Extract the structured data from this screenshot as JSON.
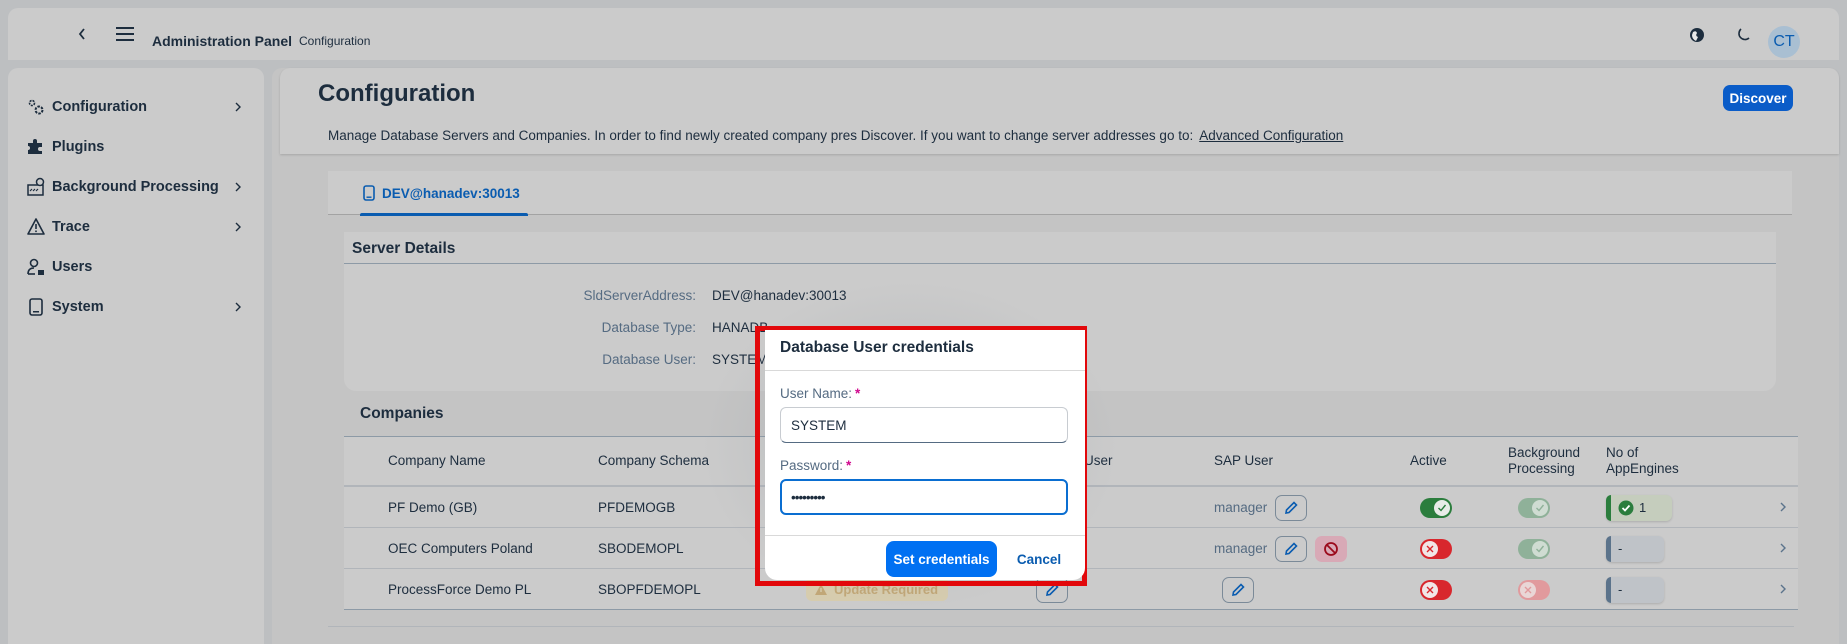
{
  "shell": {
    "title": "Administration Panel",
    "subtitle": "Configuration",
    "avatar_initials": "CT",
    "icons": {
      "back": "chevron-left-icon",
      "menu": "hamburger-menu-icon",
      "language": "globe-icon",
      "theme": "moon-icon"
    }
  },
  "sidebar": {
    "items": [
      {
        "label": "Configuration",
        "icon": "gears-icon",
        "expandable": true
      },
      {
        "label": "Plugins",
        "icon": "puzzle-icon",
        "expandable": false
      },
      {
        "label": "Background Processing",
        "icon": "background-process-icon",
        "expandable": true
      },
      {
        "label": "Trace",
        "icon": "warning-triangle-icon",
        "expandable": true
      },
      {
        "label": "Users",
        "icon": "user-list-icon",
        "expandable": false
      },
      {
        "label": "System",
        "icon": "device-icon",
        "expandable": true
      }
    ]
  },
  "page": {
    "title": "Configuration",
    "description": "Manage Database Servers and Companies. In order to find newly created company pres Discover. If you want to change server addresses go to:",
    "link_label": "Advanced Configuration",
    "discover_label": "Discover",
    "tabs": [
      {
        "label": "DEV@hanadev:30013",
        "icon": "device-icon",
        "selected": true
      }
    ]
  },
  "server_details": {
    "title": "Server Details",
    "fields": [
      {
        "label": "SldServerAddress:",
        "value": "DEV@hanadev:30013"
      },
      {
        "label": "Database Type:",
        "value": "HANADB"
      },
      {
        "label": "Database User:",
        "value": "SYSTEM"
      }
    ]
  },
  "companies": {
    "title": "Companies",
    "columns": [
      "Company Name",
      "Company Schema",
      "",
      "User",
      "SAP User",
      "Active",
      "Background Processing",
      "No of AppEngines"
    ],
    "rows": [
      {
        "name": "PF Demo (GB)",
        "schema": "PFDEMOGB",
        "status": "",
        "sap_user": "manager",
        "blocked": false,
        "active": true,
        "background": true,
        "appengines": "1",
        "appengines_ok": true
      },
      {
        "name": "OEC Computers Poland",
        "schema": "SBODEMOPL",
        "status": "",
        "sap_user": "manager",
        "blocked": true,
        "active": false,
        "background": true,
        "appengines": "-",
        "appengines_ok": false
      },
      {
        "name": "ProcessForce Demo PL",
        "schema": "SBOPFDEMOPL",
        "status": "Update Required",
        "sap_user": "",
        "blocked": false,
        "active": false,
        "background": false,
        "appengines": "-",
        "appengines_ok": false
      }
    ]
  },
  "dialog": {
    "title": "Database User credentials",
    "username_label": "User Name:",
    "username_value": "SYSTEM",
    "password_label": "Password:",
    "password_value": "•••••••••",
    "required_mark": "*",
    "primary_label": "Set credentials",
    "cancel_label": "Cancel"
  },
  "colors": {
    "accent": "#0a5cb0",
    "primary_button": "#0070f2",
    "highlight_frame": "#e2080b",
    "success": "#2b7d3d",
    "error": "#d8272d"
  }
}
